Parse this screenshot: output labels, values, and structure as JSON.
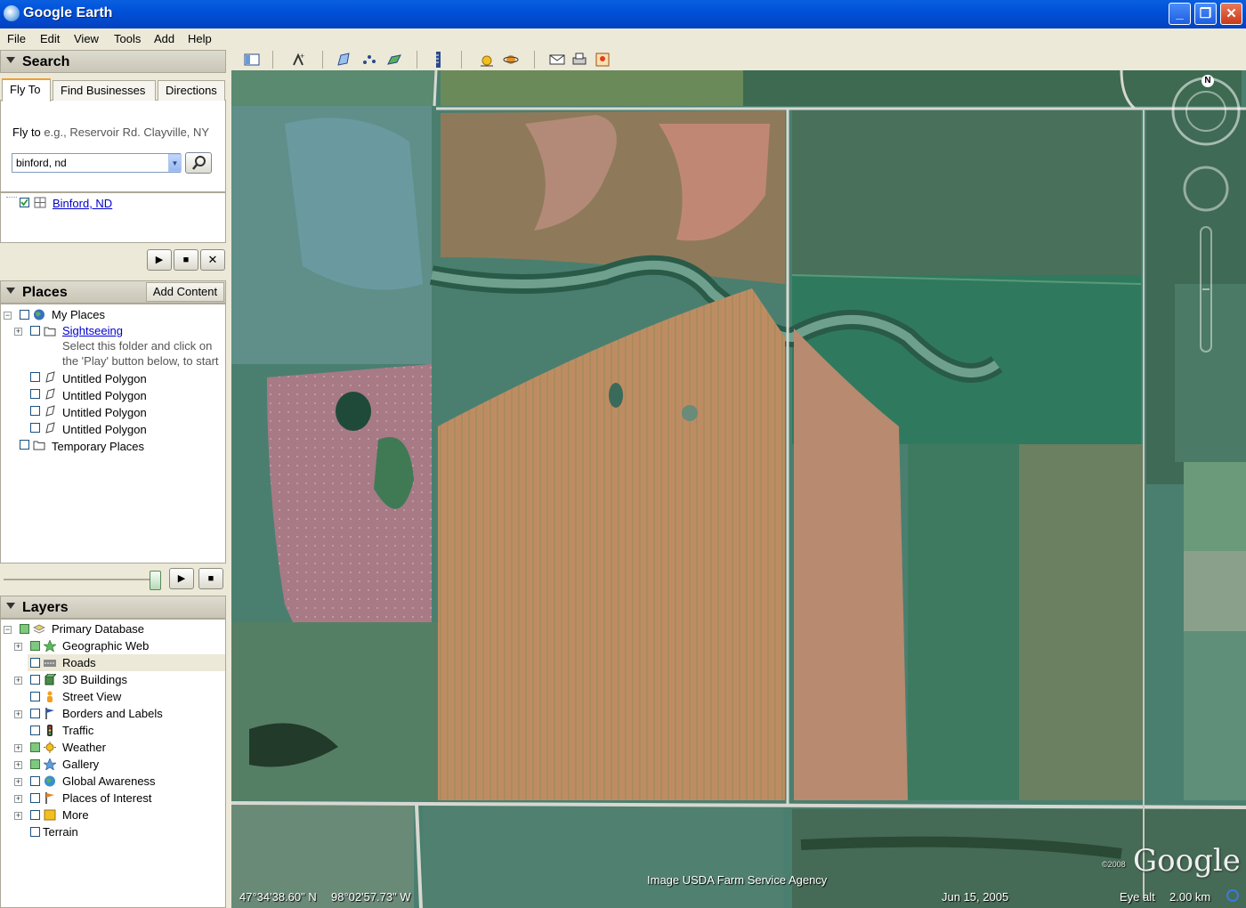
{
  "window": {
    "title": "Google Earth",
    "icon": "google-earth-icon"
  },
  "menu": [
    "File",
    "Edit",
    "View",
    "Tools",
    "Add",
    "Help"
  ],
  "search": {
    "header": "Search",
    "tabs": [
      "Fly To",
      "Find Businesses",
      "Directions"
    ],
    "fly_to_label": "Fly to",
    "fly_to_hint": "e.g., Reservoir Rd. Clayville, NY",
    "query": "binford, nd",
    "result": "Binford, ND"
  },
  "places": {
    "header": "Places",
    "add_content": "Add Content",
    "my_places": "My Places",
    "sightseeing": "Sightseeing",
    "sightseeing_hint_1": "Select this folder and click on",
    "sightseeing_hint_2": "the 'Play' button below, to start",
    "polygons": [
      "Untitled Polygon",
      "Untitled Polygon",
      "Untitled Polygon",
      "Untitled Polygon"
    ],
    "temporary": "Temporary Places"
  },
  "layers": {
    "header": "Layers",
    "root": "Primary Database",
    "items": [
      "Geographic Web",
      "Roads",
      "3D Buildings",
      "Street View",
      "Borders and Labels",
      "Traffic",
      "Weather",
      "Gallery",
      "Global Awareness",
      "Places of Interest",
      "More"
    ],
    "terrain": "Terrain"
  },
  "map": {
    "attribution": "Image USDA Farm Service Agency",
    "lat": "47°34'38.60\" N",
    "lon": "98°02'57.73\" W",
    "date": "Jun 15, 2005",
    "eye_alt_label": "Eye alt",
    "eye_alt_value": "2.00 km",
    "copyright": "©2008",
    "logo": "Google",
    "compass_north": "N"
  }
}
